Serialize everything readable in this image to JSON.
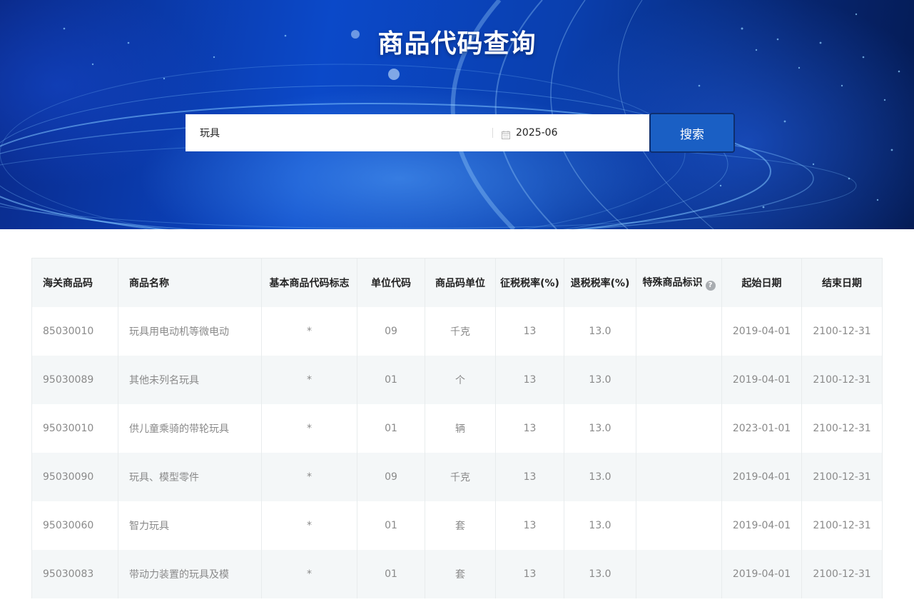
{
  "header": {
    "title": "商品代码查询"
  },
  "search": {
    "keyword_value": "玩具",
    "date_value": "2025-06",
    "button_label": "搜索",
    "calendar_icon": "calendar-icon"
  },
  "table": {
    "columns": [
      "海关商品码",
      "商品名称",
      "基本商品代码标志",
      "单位代码",
      "商品码单位",
      "征税税率(%)",
      "退税税率(%)",
      "特殊商品标识",
      "起始日期",
      "结束日期"
    ],
    "help_icon": "question-circle-icon",
    "help_icon_glyph": "?",
    "rows": [
      [
        "85030010",
        "玩具用电动机等微电动",
        "*",
        "09",
        "千克",
        "13",
        "13.0",
        "",
        "2019-04-01",
        "2100-12-31"
      ],
      [
        "95030089",
        "其他未列名玩具",
        "*",
        "01",
        "个",
        "13",
        "13.0",
        "",
        "2019-04-01",
        "2100-12-31"
      ],
      [
        "95030010",
        "供儿童乘骑的带轮玩具",
        "*",
        "01",
        "辆",
        "13",
        "13.0",
        "",
        "2023-01-01",
        "2100-12-31"
      ],
      [
        "95030090",
        "玩具、模型零件",
        "*",
        "09",
        "千克",
        "13",
        "13.0",
        "",
        "2019-04-01",
        "2100-12-31"
      ],
      [
        "95030060",
        "智力玩具",
        "*",
        "01",
        "套",
        "13",
        "13.0",
        "",
        "2019-04-01",
        "2100-12-31"
      ],
      [
        "95030083",
        "带动力装置的玩具及模",
        "*",
        "01",
        "套",
        "13",
        "13.0",
        "",
        "2019-04-01",
        "2100-12-31"
      ]
    ]
  },
  "colors": {
    "accent": "#1a5fc4",
    "header_bg": "#f4f7f8",
    "cell_text": "#8a8a8a"
  }
}
